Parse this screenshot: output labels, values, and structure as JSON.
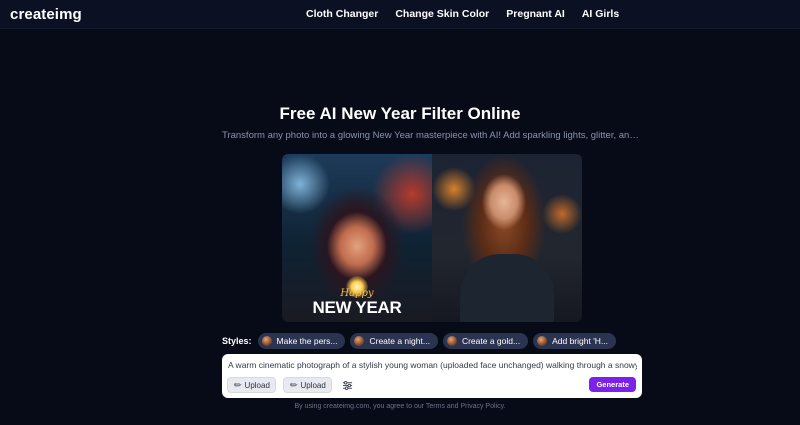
{
  "nav": {
    "logo": "createimg",
    "links": [
      "Cloth Changer",
      "Change Skin Color",
      "Pregnant AI",
      "AI Girls"
    ]
  },
  "hero": {
    "title": "Free AI New Year Filter Online",
    "subtitle": "Transform any photo into a glowing New Year masterpiece with AI! Add sparkling lights, glitter, and festi..."
  },
  "compare": {
    "left_overlay_script": "Happy",
    "left_overlay_main": "NEW YEAR"
  },
  "styles": {
    "label": "Styles:",
    "chips": [
      "Make the pers...",
      "Create a night...",
      "Create a gold...",
      "Add bright 'H..."
    ]
  },
  "prompt": {
    "text": "A warm cinematic photograph of a stylish young woman (uploaded face unchanged) walking through a snowy Europe...",
    "upload_label": "Upload",
    "generate_label": "Generate"
  },
  "footer": {
    "note": "By using createimg.com, you agree to our Terms and Privacy Policy."
  },
  "colors": {
    "background": "#070b18",
    "accent": "#7b22e8",
    "chip": "#2a3350"
  },
  "icons": [
    "paperclip-icon",
    "sliders-icon",
    "style-thumbnail-icon"
  ]
}
